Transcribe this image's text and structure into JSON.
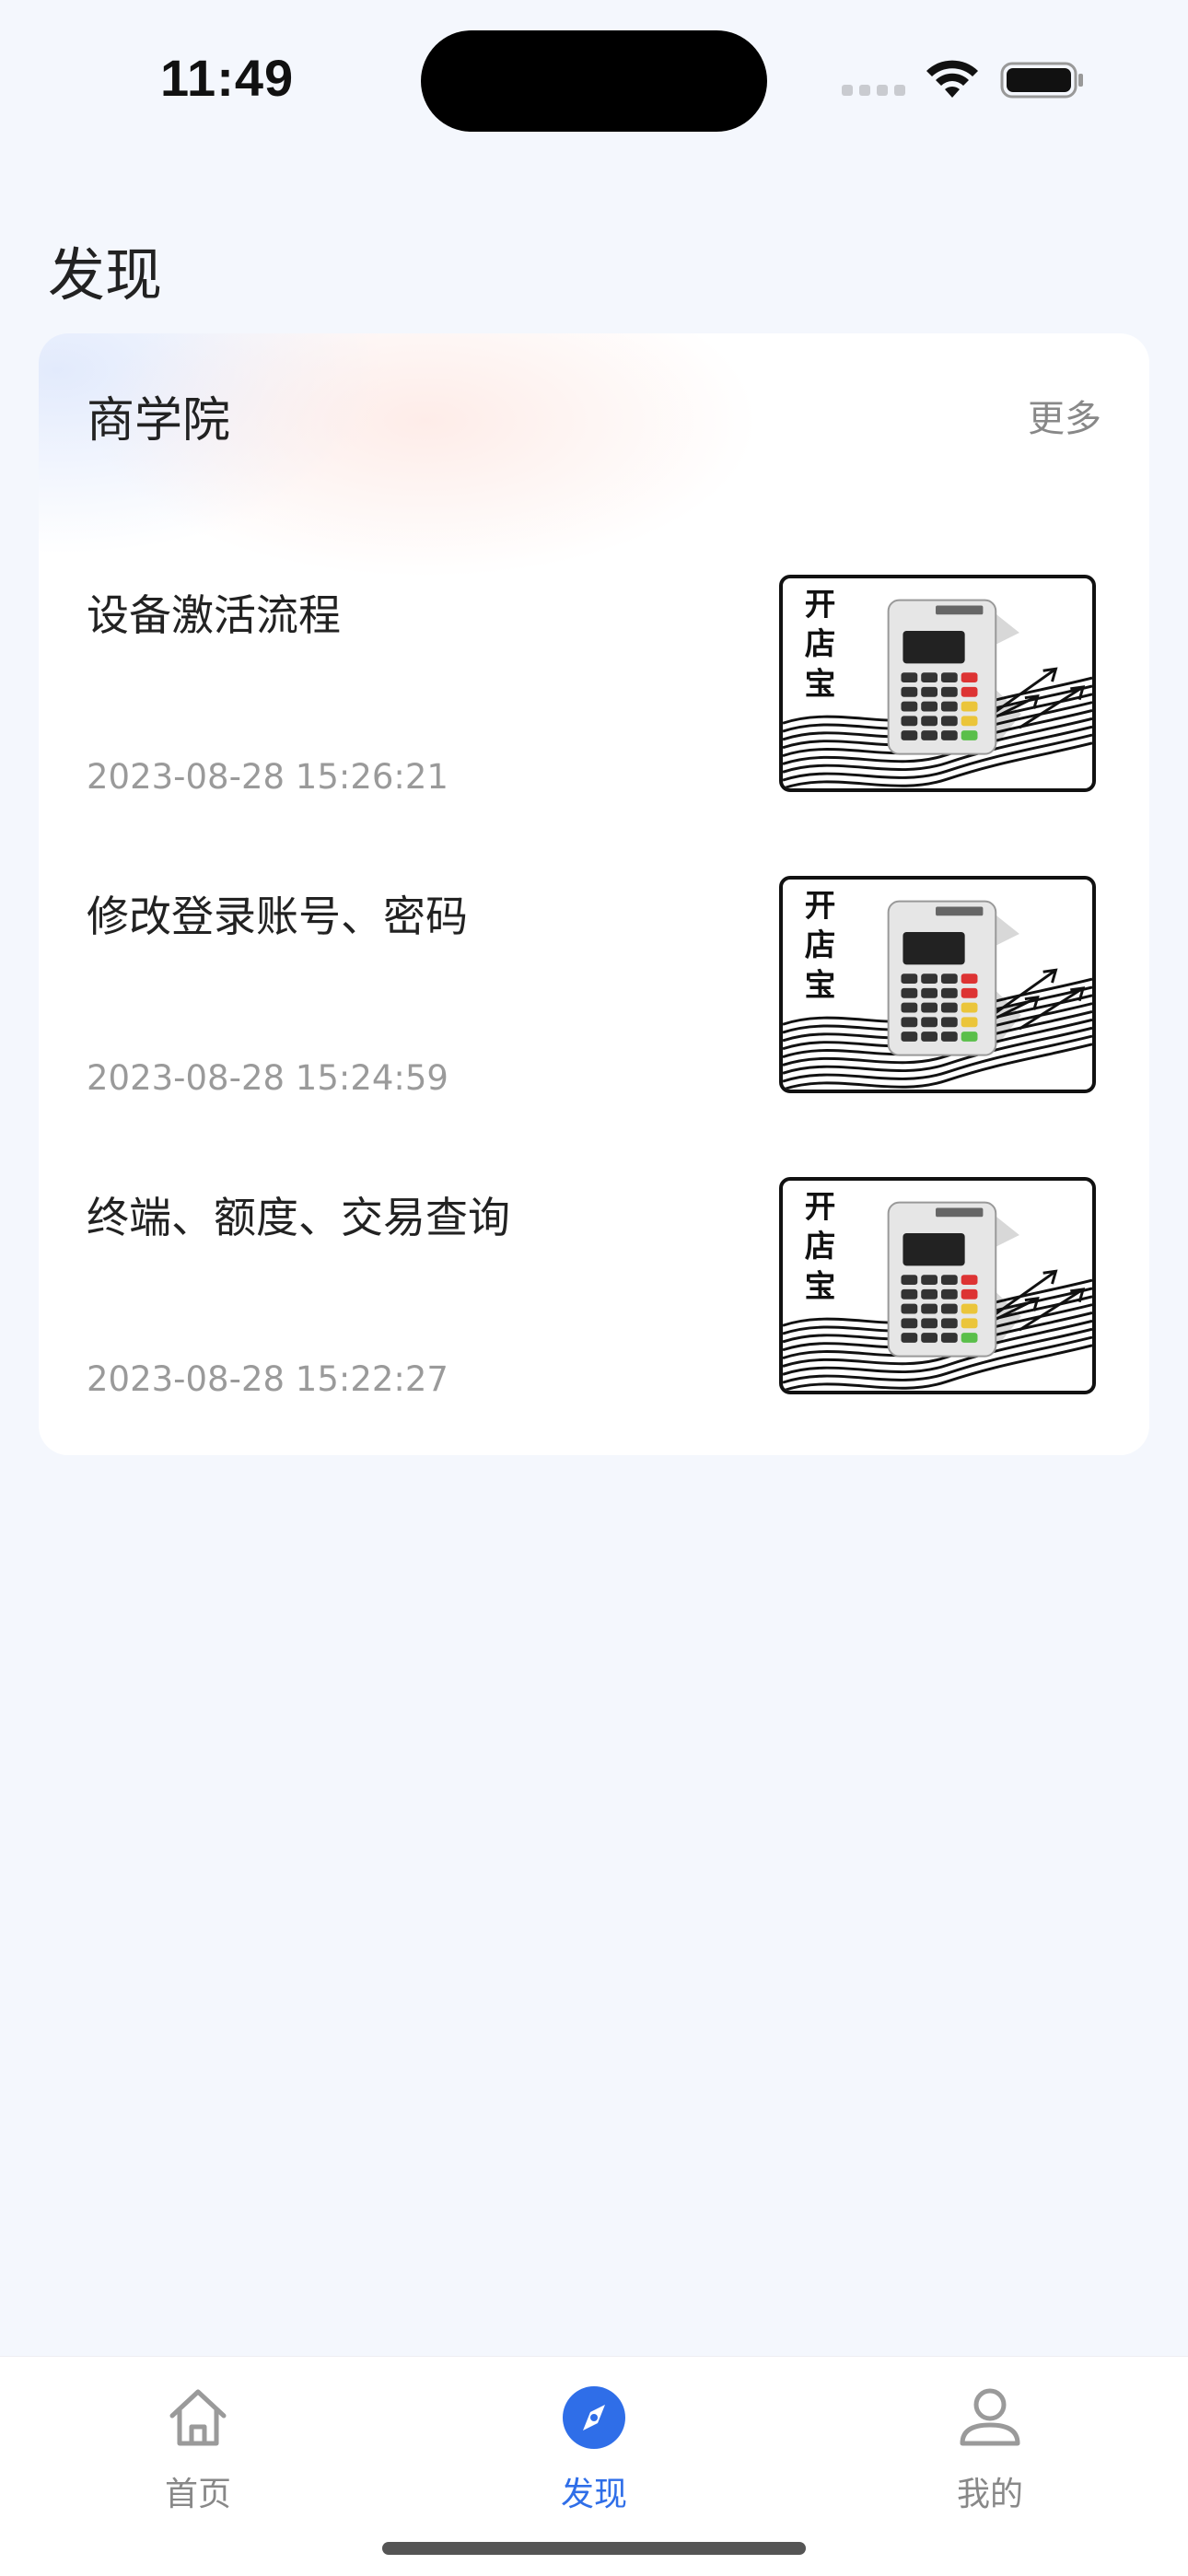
{
  "status_bar": {
    "time": "11:49"
  },
  "header": {
    "title": "发现"
  },
  "section": {
    "title": "商学院",
    "more_label": "更多",
    "articles": [
      {
        "title": "设备激活流程",
        "time": "2023-08-28 15:26:21",
        "thumb_text": [
          "开",
          "店",
          "宝"
        ]
      },
      {
        "title": "修改登录账号、密码",
        "time": "2023-08-28 15:24:59",
        "thumb_text": [
          "开",
          "店",
          "宝"
        ]
      },
      {
        "title": "终端、额度、交易查询",
        "time": "2023-08-28 15:22:27",
        "thumb_text": [
          "开",
          "店",
          "宝"
        ]
      }
    ]
  },
  "tabbar": {
    "tabs": [
      {
        "label": "首页",
        "icon": "home-icon",
        "active": false
      },
      {
        "label": "发现",
        "icon": "compass-icon",
        "active": true
      },
      {
        "label": "我的",
        "icon": "user-icon",
        "active": false
      }
    ]
  },
  "colors": {
    "accent": "#2F6EE8",
    "background": "#F4F7FD",
    "muted_text": "#9A9A9A"
  }
}
